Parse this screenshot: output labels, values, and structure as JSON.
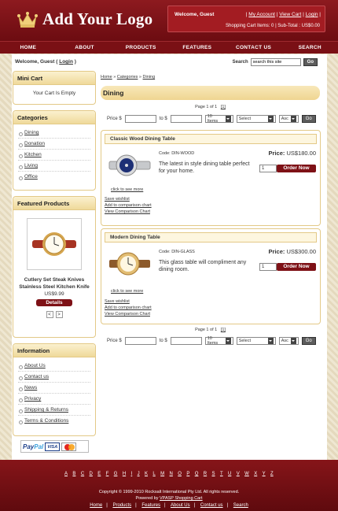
{
  "header": {
    "logo_text": "Add Your Logo",
    "welcome": "Welcome, Guest",
    "links": [
      "My Account",
      "View Cart",
      "Login"
    ],
    "cart_items": "Shopping Cart Items: 0",
    "subtotal": "Sub-Total : US$0.00"
  },
  "nav": [
    "HOME",
    "ABOUT",
    "PRODUCTS",
    "FEATURES",
    "CONTACT US",
    "SEARCH"
  ],
  "topbar": {
    "welcome_prefix": "Welcome, Guest (",
    "login": "Login",
    "welcome_suffix": ")",
    "search_label": "Search",
    "search_placeholder": "search this site",
    "go": "Go"
  },
  "mini_cart": {
    "title": "Mini Cart",
    "text": "Your Cart Is Empty"
  },
  "categories": {
    "title": "Categories",
    "items": [
      "Dining",
      "Donation",
      "Kitchen",
      "Living",
      "Office"
    ]
  },
  "featured": {
    "title": "Featured Products",
    "name": "Cutlery Set Steak Knives Stainless Steel Kitchen Knife",
    "price": "US$9.99",
    "details": "Details",
    "prev": "<",
    "next": ">"
  },
  "information": {
    "title": "Information",
    "items": [
      "About Us",
      "Contact us",
      "News",
      "Privacy",
      "Shipping & Returns",
      "Terms & Conditions"
    ]
  },
  "breadcrumb": [
    "Home",
    "Categories",
    "Dining"
  ],
  "page_title": "Dining",
  "paging": {
    "text": "Page 1 of 1",
    "link": "[1]"
  },
  "filter": {
    "price_label": "Price $",
    "to_label": "to $",
    "items": "10 Items",
    "select": "Select",
    "order": "Asc",
    "go": "Go"
  },
  "products": [
    {
      "name": "Classic Wood Dining Table",
      "code": "Code: DIN-WOOD",
      "desc": "The latest in style dining table perfect for your home.",
      "price_label": "Price:",
      "price": "US$180.00",
      "qty": "1",
      "order": "Order Now",
      "more": "click to see more",
      "actions": [
        "Save wishlist",
        "Add to comparison chart",
        "View Comparison Chart"
      ]
    },
    {
      "name": "Modern Dining Table",
      "code": "Code: DIN-GLASS",
      "desc": "This glass table will compliment any dining room.",
      "price_label": "Price:",
      "price": "US$300.00",
      "qty": "1",
      "order": "Order Now",
      "more": "click to see more",
      "actions": [
        "Save wishlist",
        "Add to comparison chart",
        "View Comparison Chart"
      ]
    }
  ],
  "payment": {
    "paypal_a": "Pay",
    "paypal_b": "Pal",
    "visa": "VISA"
  },
  "footer": {
    "letters": [
      "A",
      "B",
      "C",
      "D",
      "E",
      "F",
      "G",
      "H",
      "I",
      "J",
      "K",
      "L",
      "M",
      "N",
      "O",
      "P",
      "Q",
      "R",
      "S",
      "T",
      "U",
      "V",
      "W",
      "X",
      "Y",
      "Z"
    ],
    "copyright": "Copyright © 1999-2010 Rocksalt International Pty Ltd. All rights reserved.",
    "powered_prefix": "Powered by",
    "powered_link": "VPASP Shopping Cart",
    "links": [
      "Home",
      "Products",
      "Features",
      "About Us",
      "Contact us",
      "Search"
    ]
  },
  "colors": {
    "brand": "#7e1116",
    "header": "#8d1a1f",
    "box_border": "#e3c987",
    "box_head": "#f4e2ad"
  }
}
